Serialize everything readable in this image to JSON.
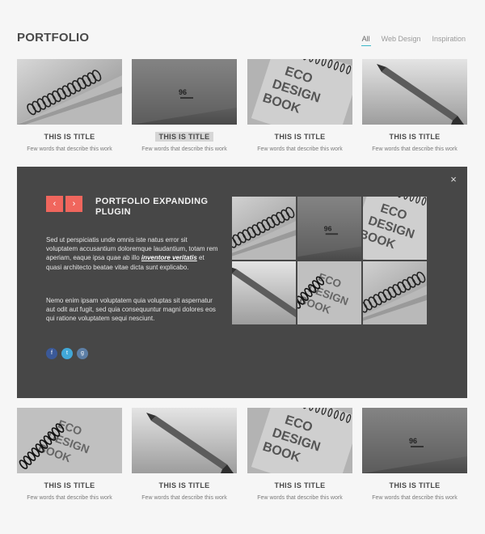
{
  "header": {
    "title": "PORTFOLIO"
  },
  "filters": [
    "All",
    "Web Design",
    "Inspiration"
  ],
  "items_top": [
    {
      "title": "THIS IS TITLE",
      "desc": "Few words that describe this work",
      "image": "spiral-notebook"
    },
    {
      "title": "THIS IS TITLE",
      "desc": "Few words that describe this work",
      "image": "notebook-cover-96",
      "highlighted": true
    },
    {
      "title": "THIS IS TITLE",
      "desc": "Few words that describe this work",
      "image": "eco-design-book"
    },
    {
      "title": "THIS IS TITLE",
      "desc": "Few words that describe this work",
      "image": "pencil"
    }
  ],
  "items_bottom": [
    {
      "title": "THIS IS TITLE",
      "desc": "Few words that describe this work",
      "image": "eco-design-book-spiral"
    },
    {
      "title": "THIS IS TITLE",
      "desc": "Few words that describe this work",
      "image": "pencil"
    },
    {
      "title": "THIS IS TITLE",
      "desc": "Few words that describe this work",
      "image": "eco-design-book"
    },
    {
      "title": "THIS IS TITLE",
      "desc": "Few words that describe this work",
      "image": "notebook-cover-96"
    }
  ],
  "preview": {
    "title": "PORTFOLIO EXPANDING PLUGIN",
    "prev_icon": "‹",
    "next_icon": "›",
    "close_icon": "×",
    "p1_before": "Sed ut perspiciatis unde omnis iste natus error sit voluptatem accusantium doloremque laudantium, totam rem aperiam, eaque ipsa quae ab illo ",
    "p1_link": "inventore veritatis",
    "p1_after": " et quasi architecto beatae vitae dicta sunt explicabo.",
    "p2": "Nemo enim ipsam voluptatem quia voluptas sit aspernatur aut odit aut fugit, sed quia consequuntur magni dolores eos qui ratione voluptatem sequi nesciunt.",
    "social": {
      "facebook": "f",
      "twitter": "t",
      "google": "g"
    },
    "gallery": [
      "spiral-notebook",
      "notebook-cover-96",
      "eco-design-book",
      "pencil",
      "eco-design-book-spiral",
      "spiral-notebook"
    ]
  },
  "book_text": {
    "eco": "ECO",
    "design": "DESIGN",
    "book": "BOOK",
    "number": "96"
  },
  "colors": {
    "accent": "#f0665d",
    "filter_underline": "#3bb7c9",
    "preview_bg": "#474747"
  }
}
